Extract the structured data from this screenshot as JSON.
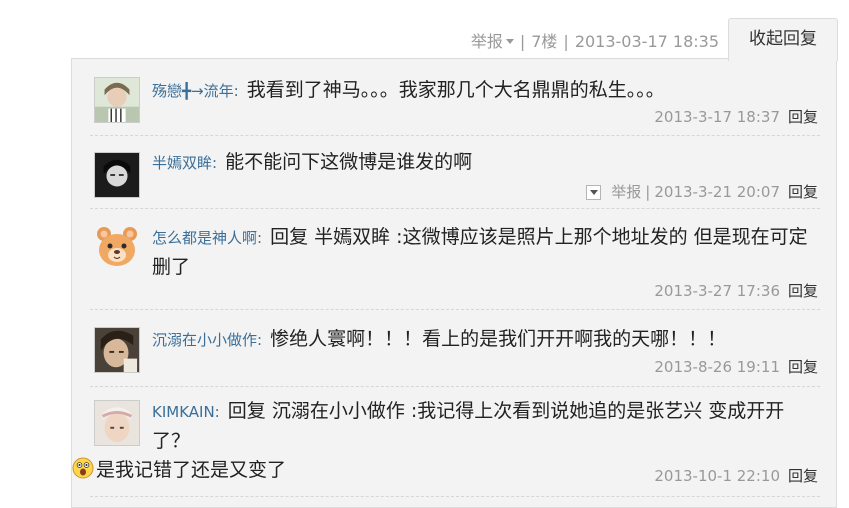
{
  "floor": {
    "report_label": "举报",
    "separator": "|",
    "floor_number": "7楼",
    "timestamp": "2013-03-17 18:35",
    "collapse_label": "收起回复"
  },
  "comments": [
    {
      "username": "殇戀╋→流年:",
      "text": " 我看到了神马。。。我家那几个大名鼎鼎的私生。。。",
      "timestamp": "2013-3-17 18:37",
      "reply_label": "回复"
    },
    {
      "username": "半嫣双眸:",
      "text": " 能不能问下这微博是谁发的啊",
      "report_label": "举报",
      "separator": "|",
      "timestamp": "2013-3-21 20:07",
      "reply_label": "回复"
    },
    {
      "username": "怎么都是神人啊:",
      "text": " 回复 半嫣双眸 :这微博应该是照片上那个地址发的 但是现在可定删了",
      "timestamp": "2013-3-27 17:36",
      "reply_label": "回复"
    },
    {
      "username": "沉溺在小小做作:",
      "text": " 惨绝人寰啊！！！看上的是我们开开啊我的天哪！！！",
      "timestamp": "2013-8-26 19:11",
      "reply_label": "回复"
    },
    {
      "username": "KIMKAIN:",
      "text": " 回复 沉溺在小小做作 :我记得上次看到说她追的是张艺兴 变成开开了？",
      "text_line2": "是我记错了还是又变了",
      "emoji_icon": "shocked-face-icon",
      "timestamp": "2013-10-1 22:10",
      "reply_label": "回复"
    }
  ],
  "colors": {
    "username": "#3a6f99",
    "meta": "#999999",
    "panel_bg": "#f3f3f3",
    "border": "#dcdcdc"
  }
}
